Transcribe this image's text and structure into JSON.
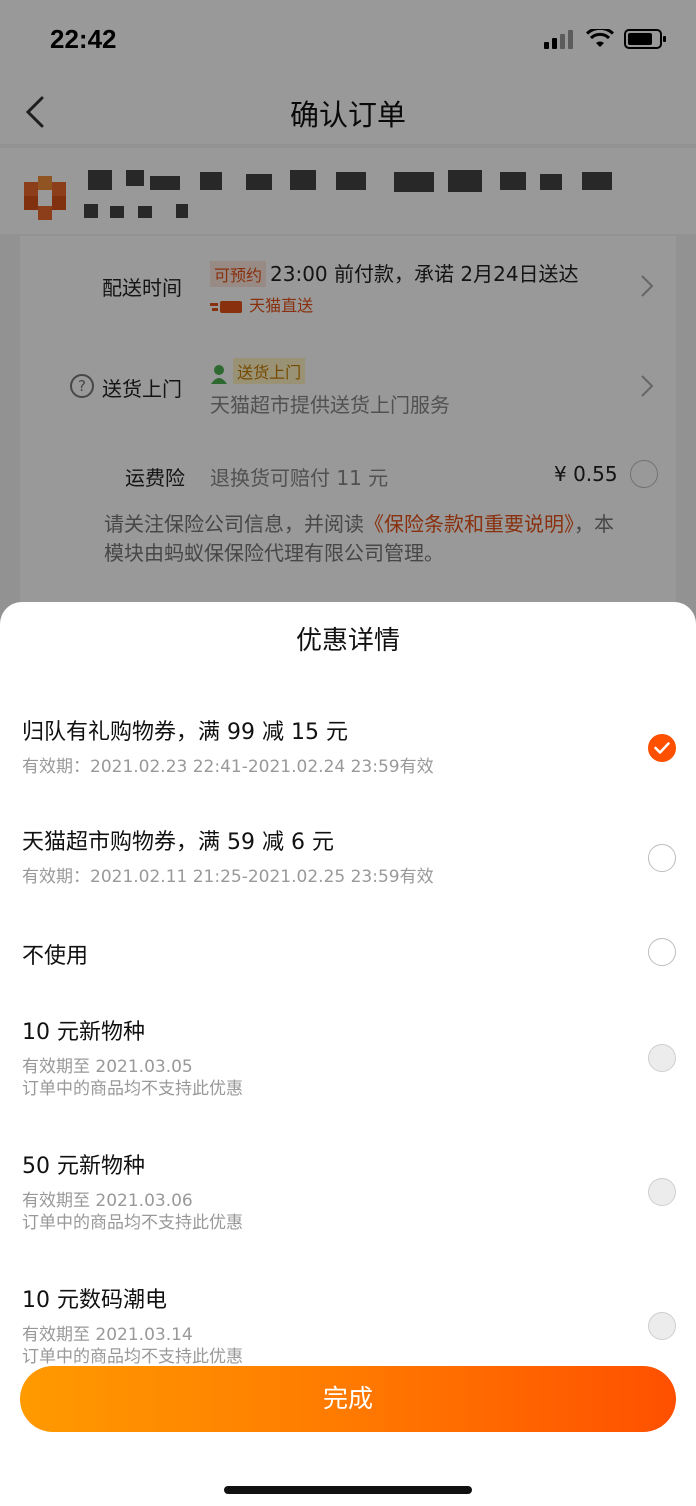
{
  "status_bar": {
    "time": "22:42"
  },
  "nav": {
    "title": "确认订单"
  },
  "delivery": {
    "label": "配送时间",
    "tag": "可预约",
    "text": "23:00 前付款，承诺 2月24日送达",
    "brand": "天猫直送"
  },
  "home_delivery": {
    "label": "送货上门",
    "tag": "送货上门",
    "text": "天猫超市提供送货上门服务"
  },
  "shipping_insurance": {
    "label": "运费险",
    "text": "退换货可赔付 11 元",
    "price": "¥ 0.55"
  },
  "insurance_note": {
    "prefix": "请关注保险公司信息，并阅读",
    "link": "《保险条款和重要说明》",
    "suffix": "，本模块由蚂蚁保保险代理有限公司管理。"
  },
  "sheet": {
    "title": "优惠详情",
    "coupons": [
      {
        "name": "归队有礼购物券，满 99 减 15 元",
        "validity": "有效期：2021.02.23 22:41-2021.02.24 23:59有效",
        "note": "",
        "state": "checked"
      },
      {
        "name": "天猫超市购物券，满 59 减 6 元",
        "validity": "有效期：2021.02.11 21:25-2021.02.25 23:59有效",
        "note": "",
        "state": "unchecked"
      },
      {
        "name": "不使用",
        "validity": "",
        "note": "",
        "state": "unchecked"
      },
      {
        "name": "10 元新物种",
        "validity": "有效期至 2021.03.05",
        "note": "订单中的商品均不支持此优惠",
        "state": "disabled"
      },
      {
        "name": "50 元新物种",
        "validity": "有效期至 2021.03.06",
        "note": "订单中的商品均不支持此优惠",
        "state": "disabled"
      },
      {
        "name": "10 元数码潮电",
        "validity": "有效期至 2021.03.14",
        "note": "订单中的商品均不支持此优惠",
        "state": "disabled"
      }
    ],
    "done_label": "完成"
  },
  "colors": {
    "accent": "#ff5000",
    "gradient_start": "#ff9a00",
    "gradient_end": "#ff5000"
  }
}
